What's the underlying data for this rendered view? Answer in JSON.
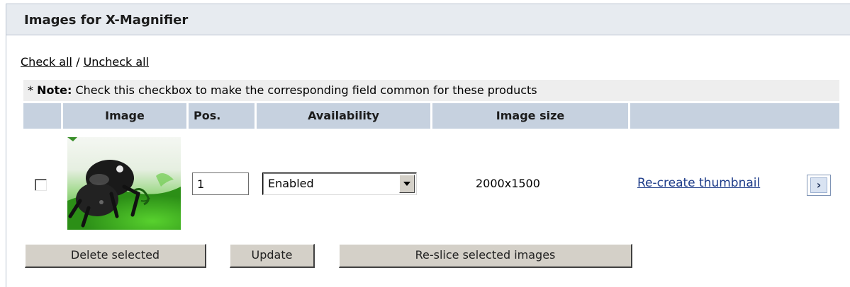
{
  "panel": {
    "title": "Images for X-Magnifier"
  },
  "check_links": {
    "check_all": "Check all",
    "separator": " / ",
    "uncheck_all": "Uncheck all"
  },
  "note": {
    "prefix": "* ",
    "label": "Note:",
    "text": " Check this checkbox to make the corresponding field common for these products"
  },
  "table": {
    "headers": {
      "checkbox": "",
      "image": "Image",
      "pos": "Pos.",
      "availability": "Availability",
      "image_size": "Image size",
      "actions": ""
    },
    "rows": [
      {
        "checked": false,
        "image": "green-beetle-thumbnail",
        "pos": "1",
        "availability": "Enabled",
        "image_size": "2000x1500",
        "action_label": "Re-create thumbnail",
        "action_icon": "arrow-right-icon"
      }
    ]
  },
  "buttons": {
    "delete": "Delete selected",
    "update": "Update",
    "reslice": "Re-slice selected images"
  },
  "colors": {
    "header_bg": "#e7ebf0",
    "table_header_bg": "#c6d1df",
    "note_bg": "#eeeeee",
    "link": "#1f3d8a",
    "button_bg": "#d4d0c8"
  }
}
